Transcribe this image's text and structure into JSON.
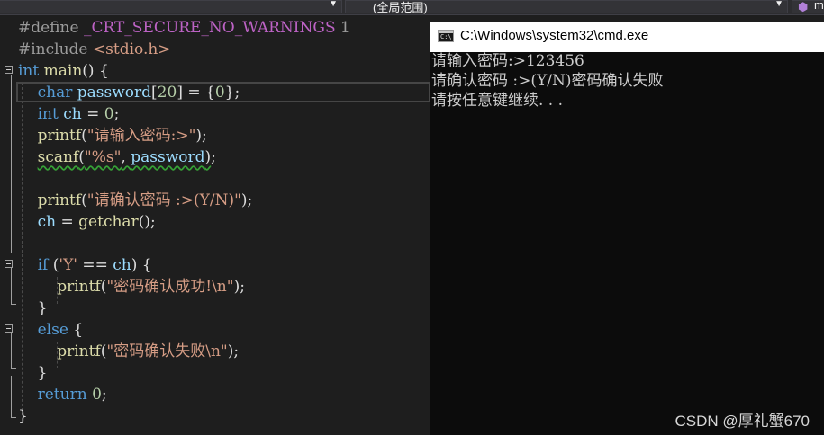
{
  "nav_bar": {
    "scope_label": "(全局范围)",
    "member_label": "m"
  },
  "code_lines": [
    [
      {
        "t": "#define ",
        "c": "pp"
      },
      {
        "t": "_CRT_SECURE_NO_WARNINGS",
        "c": "macro"
      },
      {
        "t": " 1",
        "c": "pp"
      }
    ],
    [
      {
        "t": "#include ",
        "c": "pp"
      },
      {
        "t": "<stdio.h>",
        "c": "str"
      }
    ],
    [
      {
        "t": "int",
        "c": "kw"
      },
      {
        "t": " "
      },
      {
        "t": "main",
        "c": "fn"
      },
      {
        "t": "() {"
      }
    ],
    [
      {
        "t": "    "
      },
      {
        "t": "char",
        "c": "kw"
      },
      {
        "t": " "
      },
      {
        "t": "password",
        "c": "var"
      },
      {
        "t": "["
      },
      {
        "t": "20",
        "c": "num"
      },
      {
        "t": "] = {"
      },
      {
        "t": "0",
        "c": "num"
      },
      {
        "t": "};"
      }
    ],
    [
      {
        "t": "    "
      },
      {
        "t": "int",
        "c": "kw"
      },
      {
        "t": " "
      },
      {
        "t": "ch",
        "c": "var"
      },
      {
        "t": " = "
      },
      {
        "t": "0",
        "c": "num"
      },
      {
        "t": ";"
      }
    ],
    [
      {
        "t": "    "
      },
      {
        "t": "printf",
        "c": "fn"
      },
      {
        "t": "("
      },
      {
        "t": "\"请输入密码:>\"",
        "c": "str"
      },
      {
        "t": ");"
      }
    ],
    [
      {
        "t": "    "
      },
      {
        "t": "scanf",
        "c": "fn sq"
      },
      {
        "t": "(",
        "c": "sq"
      },
      {
        "t": "\"%s\"",
        "c": "str sq"
      },
      {
        "t": ", ",
        "c": "sq"
      },
      {
        "t": "password",
        "c": "var sq"
      },
      {
        "t": ")",
        "c": "sq"
      },
      {
        "t": ";"
      }
    ],
    [
      {
        "t": ""
      }
    ],
    [
      {
        "t": "    "
      },
      {
        "t": "printf",
        "c": "fn"
      },
      {
        "t": "("
      },
      {
        "t": "\"请确认密码 :>(Y/N)\"",
        "c": "str"
      },
      {
        "t": ");"
      }
    ],
    [
      {
        "t": "    "
      },
      {
        "t": "ch",
        "c": "var"
      },
      {
        "t": " = "
      },
      {
        "t": "getchar",
        "c": "fn"
      },
      {
        "t": "();"
      }
    ],
    [
      {
        "t": ""
      }
    ],
    [
      {
        "t": "    "
      },
      {
        "t": "if",
        "c": "kw"
      },
      {
        "t": " ("
      },
      {
        "t": "'Y'",
        "c": "str"
      },
      {
        "t": " == "
      },
      {
        "t": "ch",
        "c": "var"
      },
      {
        "t": ") {"
      }
    ],
    [
      {
        "t": "        "
      },
      {
        "t": "printf",
        "c": "fn"
      },
      {
        "t": "("
      },
      {
        "t": "\"密码确认成功!",
        "c": "str"
      },
      {
        "t": "\\n",
        "c": "str"
      },
      {
        "t": "\"",
        "c": "str"
      },
      {
        "t": ");"
      }
    ],
    [
      {
        "t": "    }"
      }
    ],
    [
      {
        "t": "    "
      },
      {
        "t": "else",
        "c": "kw"
      },
      {
        "t": " {"
      }
    ],
    [
      {
        "t": "        "
      },
      {
        "t": "printf",
        "c": "fn"
      },
      {
        "t": "("
      },
      {
        "t": "\"密码确认失败",
        "c": "str"
      },
      {
        "t": "\\n",
        "c": "str"
      },
      {
        "t": "\"",
        "c": "str"
      },
      {
        "t": ");"
      }
    ],
    [
      {
        "t": "    }"
      }
    ],
    [
      {
        "t": "    "
      },
      {
        "t": "return",
        "c": "kw"
      },
      {
        "t": " "
      },
      {
        "t": "0",
        "c": "num"
      },
      {
        "t": ";"
      }
    ],
    [
      {
        "t": "}"
      }
    ]
  ],
  "console": {
    "title": "C:\\Windows\\system32\\cmd.exe",
    "icon_text": "C:\\",
    "lines": [
      "请输入密码:>123456",
      "请确认密码 :>(Y/N)密码确认失败",
      "请按任意键继续. . ."
    ]
  },
  "watermark": "CSDN @厚礼蟹670",
  "colors": {
    "editor_bg": "#1e1e1e",
    "keyword": "#569cd6",
    "string": "#d69d85",
    "function": "#dcdcaa",
    "variable": "#9cdcfe",
    "number": "#b5cea8",
    "macro": "#bd63c5",
    "console_bg": "#0c0c0c"
  }
}
